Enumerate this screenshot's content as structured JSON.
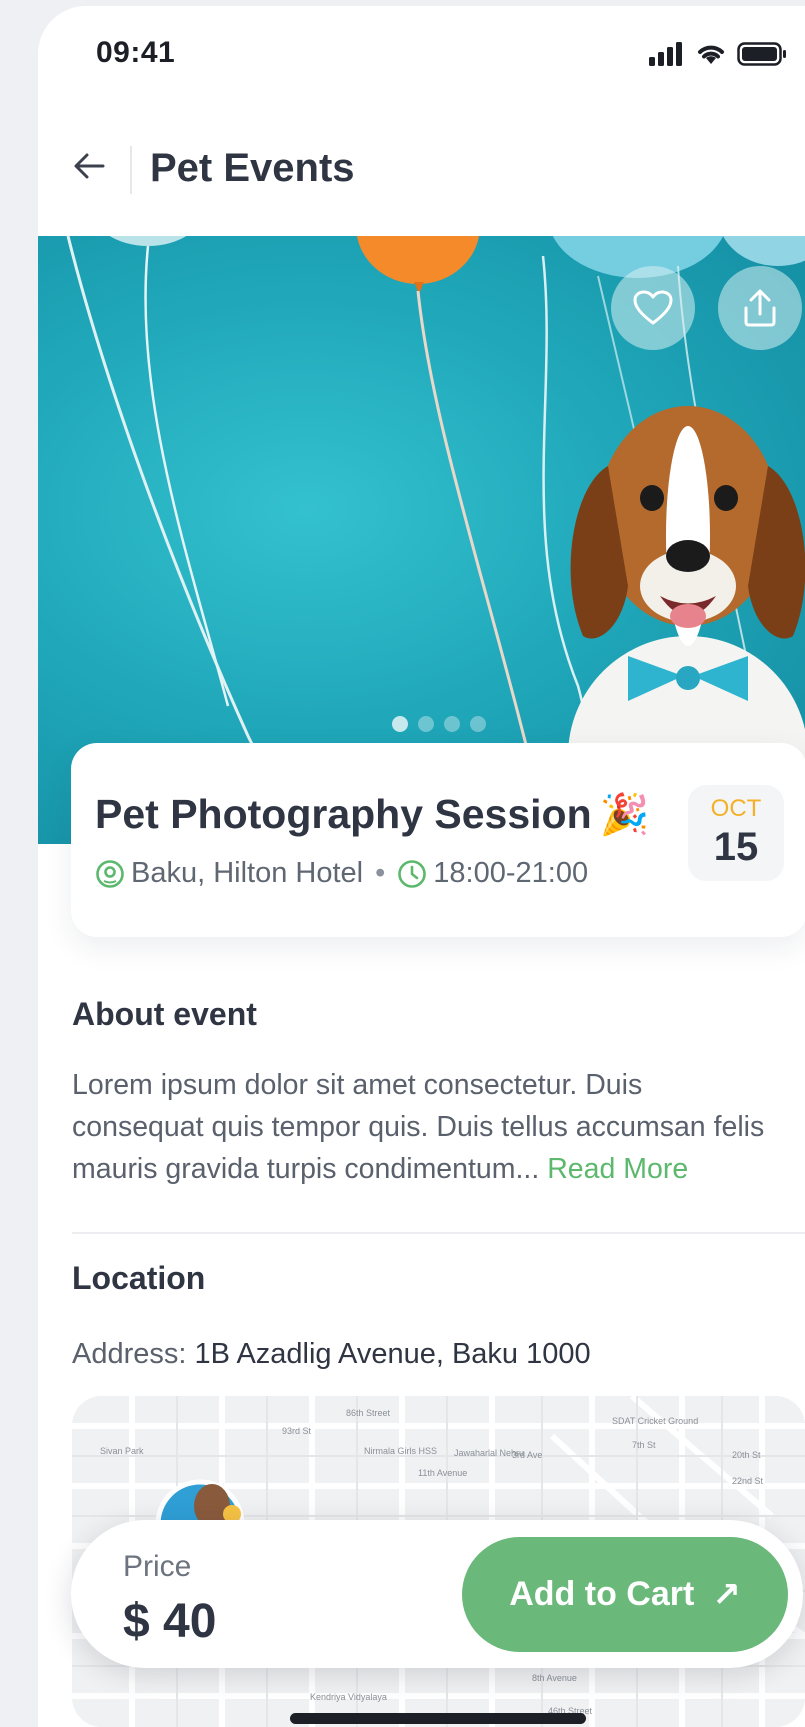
{
  "status_bar": {
    "time": "09:41"
  },
  "header": {
    "title": "Pet Events"
  },
  "event": {
    "title": "Pet Photography Session",
    "emoji": "🎉",
    "location": "Baku, Hilton Hotel",
    "separator": "•",
    "time": "18:00-21:00",
    "date_month": "OCT",
    "date_day": "15",
    "gallery_page_count": 4,
    "gallery_active_index": 0
  },
  "about": {
    "title": "About event",
    "text": "Lorem ipsum dolor sit amet consectetur. Duis consequat quis tempor quis. Duis tellus accumsan felis mauris gravida turpis condimentum... ",
    "read_more": "Read More"
  },
  "location": {
    "title": "Location",
    "address_label": "Address:",
    "address": "1B Azadlig Avenue, Baku 1000",
    "map_labels": {
      "l1": "86th Street",
      "l2": "Sivan Park",
      "l3": "93rd St",
      "l4": "Nirmala Girls HSS",
      "l5": "3rd Ave",
      "l6": "SDAT Cricket Ground",
      "l7": "20th St",
      "l8": "22nd St",
      "l9": "8th Avenue",
      "l10": "Kendriya Vidyalaya",
      "l11": "46th Street",
      "l12": "Jawaharlal Nehru",
      "l13": "11th Avenue",
      "l14": "7th St"
    }
  },
  "purchase": {
    "price_label": "Price",
    "price_value": "$ 40",
    "cart_label": "Add to Cart",
    "cart_arrow": "↗"
  },
  "icons": {
    "back": "arrow-left-icon",
    "favorite": "heart-icon",
    "share": "share-icon",
    "location": "location-pin-icon",
    "clock": "clock-icon"
  },
  "colors": {
    "accent_green": "#6ab87a",
    "date_month": "#f3b12a",
    "hero_bg": "#20a8ba"
  }
}
